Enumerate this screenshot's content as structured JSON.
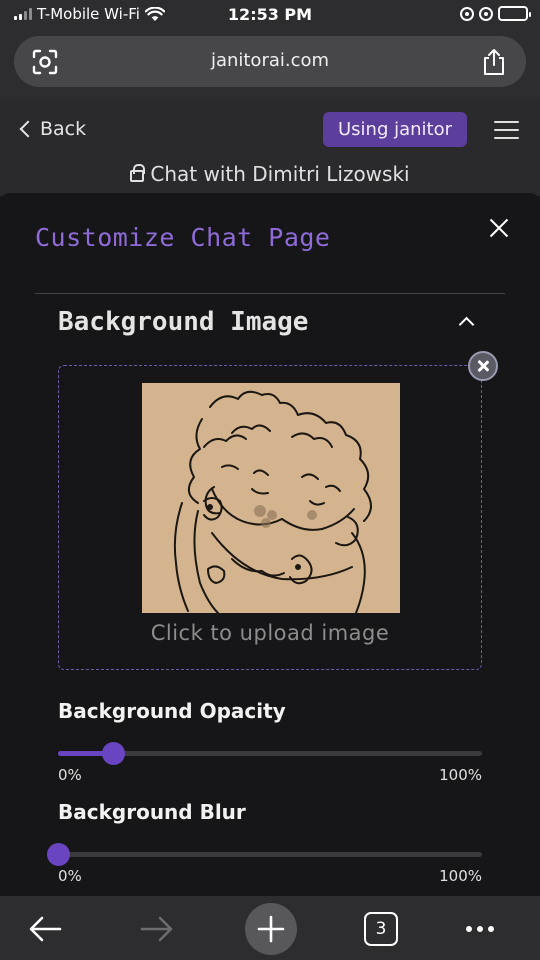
{
  "status_bar": {
    "carrier": "T-Mobile Wi-Fi",
    "time": "12:53 PM"
  },
  "browser": {
    "url": "janitorai.com",
    "icons": [
      "scan-icon",
      "share-icon"
    ]
  },
  "site_header": {
    "back_label": "Back",
    "using_label": "Using janitor",
    "chat_title": "Chat with Dimitri Lizowski"
  },
  "modal": {
    "title": "Customize Chat Page",
    "section_title": "Background Image",
    "upload_text": "Click to upload image",
    "opacity": {
      "label": "Background Opacity",
      "min": "0%",
      "max": "100%",
      "value": 13
    },
    "blur": {
      "label": "Background Blur",
      "min": "0%",
      "max": "100%",
      "value": 0
    }
  },
  "toolbar": {
    "tabs_count": "3"
  },
  "colors": {
    "accent": "#6a45c2",
    "title_purple": "#8f6bd8",
    "badge_purple": "#5c3e9c",
    "image_bg": "#d3b48f"
  }
}
